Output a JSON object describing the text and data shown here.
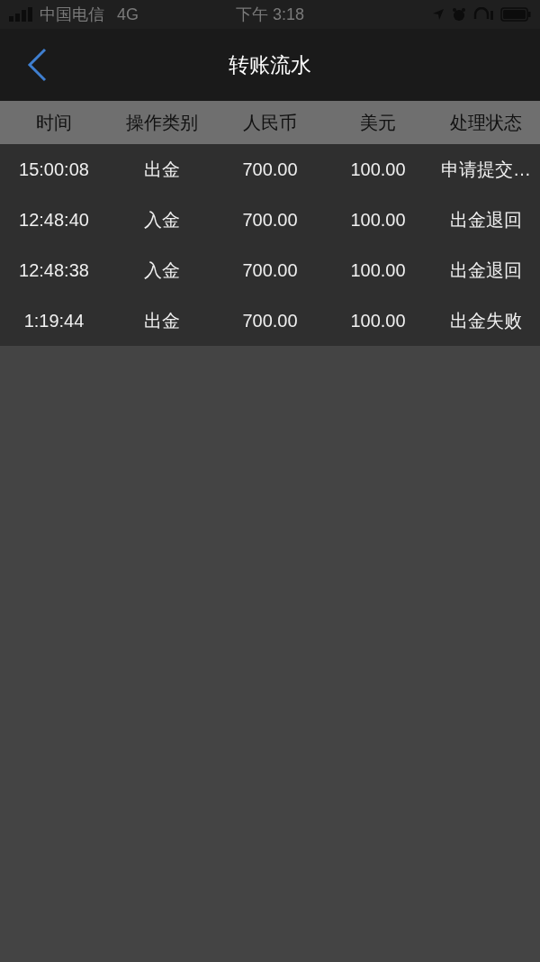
{
  "status_bar": {
    "carrier": "中国电信",
    "network": "4G",
    "time": "下午 3:18"
  },
  "nav": {
    "title": "转账流水"
  },
  "table": {
    "columns": [
      "时间",
      "操作类别",
      "人民币",
      "美元",
      "处理状态"
    ],
    "rows": [
      {
        "cells": [
          "15:00:08",
          "出金",
          "700.00",
          "100.00",
          "申请提交…"
        ]
      },
      {
        "cells": [
          "12:48:40",
          "入金",
          "700.00",
          "100.00",
          "出金退回"
        ]
      },
      {
        "cells": [
          "12:48:38",
          "入金",
          "700.00",
          "100.00",
          "出金退回"
        ]
      },
      {
        "cells": [
          "1:19:44",
          "出金",
          "700.00",
          "100.00",
          "出金失败"
        ]
      }
    ]
  }
}
